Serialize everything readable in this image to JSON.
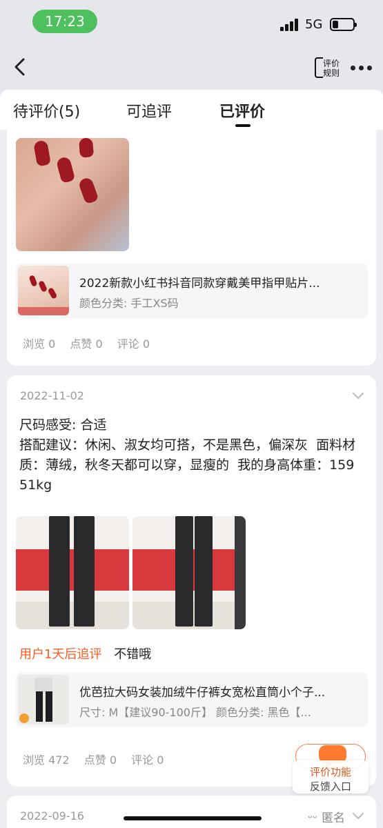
{
  "status": {
    "time": "17:23",
    "network": "5G"
  },
  "nav": {
    "rule_label": "评价规则"
  },
  "tabs": [
    {
      "label": "待评价(5)"
    },
    {
      "label": "可追评"
    },
    {
      "label": "已评价",
      "active": true
    }
  ],
  "reviews": [
    {
      "product": {
        "title": "2022新款小红书抖音同款穿戴美甲指甲贴片...",
        "spec": "颜色分类: 手工XS码"
      },
      "stats": {
        "views": "浏览 0",
        "likes": "点赞 0",
        "comments": "评论 0"
      }
    },
    {
      "date": "2022-11-02",
      "text": "尺码感受: 合适\n搭配建议：休闲、淑女均可搭，不是黑色，偏深灰  面料材质：薄绒，秋冬天都可以穿，显瘦的  我的身高体重：159 51kg",
      "followup": {
        "tag": "用户1天后追评",
        "text": "不错哦"
      },
      "product": {
        "title": "优芭拉大码女装加绒牛仔裤女宽松直筒小个子...",
        "spec": "尺寸: M【建议90-100斤】 颜色分类: 黑色【..."
      },
      "stats": {
        "views": "浏览 472",
        "likes": "点赞 0",
        "comments": "评论 0"
      }
    },
    {
      "date": "2022-09-16",
      "privacy": "匿名"
    }
  ],
  "feedback": {
    "line1": "评价功能",
    "line2": "反馈入口"
  },
  "colors": {
    "accent": "#ff5a1f",
    "time_pill": "#4ec05e"
  }
}
